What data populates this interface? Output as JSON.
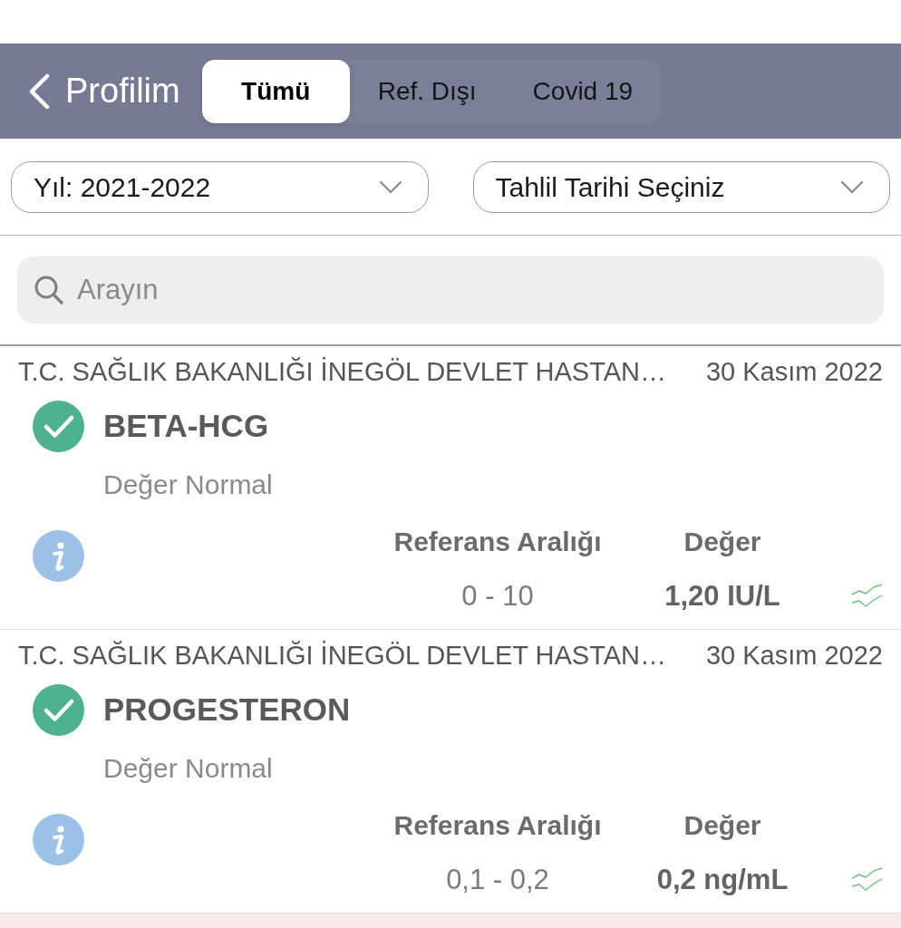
{
  "header": {
    "back_label": "Profilim",
    "tabs": [
      {
        "label": "Tümü",
        "selected": true
      },
      {
        "label": "Ref. Dışı",
        "selected": false
      },
      {
        "label": "Covid 19",
        "selected": false
      }
    ]
  },
  "filters": [
    {
      "text": "Yıl: 2021-2022"
    },
    {
      "text": "Tahlil Tarihi Seçiniz"
    }
  ],
  "search": {
    "placeholder": "Arayın"
  },
  "results": [
    {
      "out_of_range": false,
      "institution": "T.C. SAĞLIK BAKANLIĞI İNEGÖL DEVLET HASTAN…",
      "date": "30 Kasım 2022",
      "test": "BETA-HCG",
      "status_text": "Değer Normal",
      "reference_label": "Referans Aralığı",
      "value_label": "Değer",
      "reference_range": "0 - 10",
      "value": "1,20 IU/L"
    },
    {
      "out_of_range": false,
      "institution": "T.C. SAĞLIK BAKANLIĞI İNEGÖL DEVLET HASTAN…",
      "date": "30 Kasım 2022",
      "test": "PROGESTERON",
      "status_text": "Değer Normal",
      "reference_label": "Referans Aralığı",
      "value_label": "Değer",
      "reference_range": "0,1 - 0,2",
      "value": "0,2 ng/mL"
    },
    {
      "out_of_range": true
    }
  ]
}
